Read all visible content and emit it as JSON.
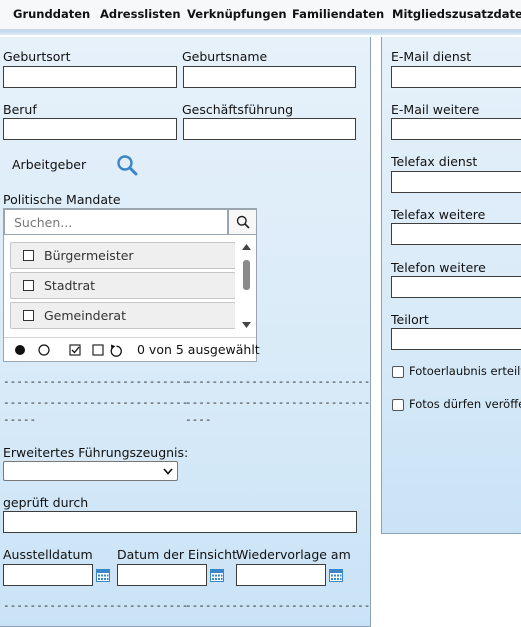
{
  "tabs": [
    "Grunddaten",
    "Adresslisten",
    "Verknüpfungen",
    "Familiendaten",
    "Mitgliedszusatzdaten"
  ],
  "left": {
    "geburtsort_label": "Geburtsort",
    "geburtsname_label": "Geburtsname",
    "beruf_label": "Beruf",
    "geschaeftsfuehrung_label": "Geschäftsführung",
    "arbeitgeber_label": "Arbeitgeber",
    "mandate_label": "Politische Mandate",
    "search_placeholder": "Suchen...",
    "options": [
      "Bürgermeister",
      "Stadtrat",
      "Gemeinderat"
    ],
    "selected_count": "0 von 5 ausgewählt",
    "dashes_a": "----------------------------",
    "dashes_b": "----------------------------",
    "dashes_c": "----------------------------",
    "dashes_d": "----------------------------",
    "dashes_e": "-----",
    "dashes_f": "----",
    "zeugnis_label": "Erweitertes Führungszeugnis:",
    "zeugnis_value": "",
    "geprueft_label": "geprüft durch",
    "ausstell_label": "Ausstelldatum",
    "einsicht_label": "Datum der Einsicht",
    "wiedervorlage_label": "Wiedervorlage am",
    "dashes_g": "----------------------------",
    "dashes_h": "----------------------------"
  },
  "right": {
    "email_dienst_label": "E-Mail dienst",
    "email_weitere_label": "E-Mail weitere",
    "telefax_dienst_label": "Telefax dienst",
    "telefax_weitere_label": "Telefax weitere",
    "telefon_weitere_label": "Telefon weitere",
    "teilort_label": "Teilort",
    "foto_erlaubnis_label": "Fotoerlaubnis erteilt",
    "fotos_label": "Fotos dürfen veröffen"
  },
  "colors": {
    "panel_bg": "#d8eaf8",
    "panel_border": "#8da2b4",
    "icon_blue": "#3a86c8"
  }
}
